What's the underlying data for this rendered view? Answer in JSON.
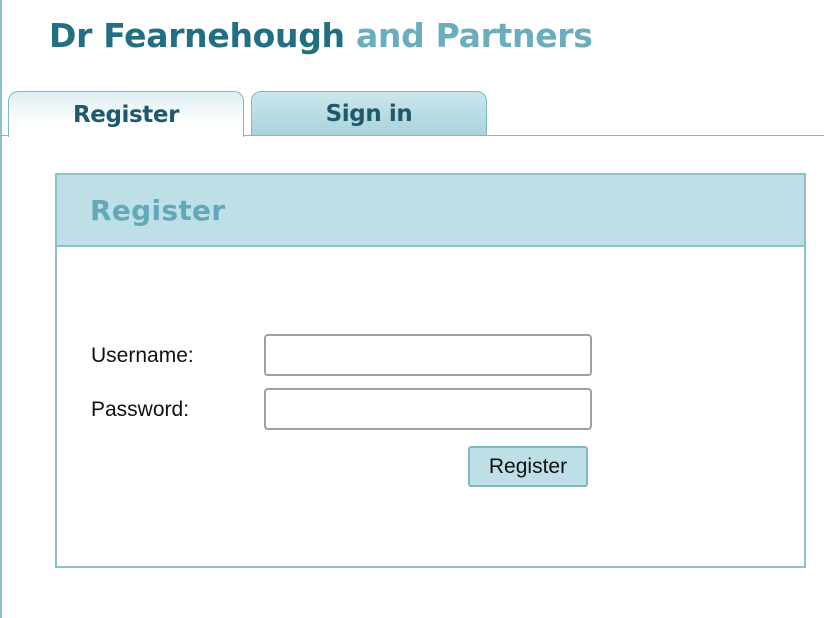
{
  "header": {
    "title_main": "Dr Fearnehough",
    "title_sub": "and Partners"
  },
  "tabs": [
    {
      "label": "Register",
      "active": true
    },
    {
      "label": "Sign in",
      "active": false
    }
  ],
  "panel": {
    "title": "Register",
    "fields": {
      "username": {
        "label": "Username:",
        "value": "",
        "placeholder": ""
      },
      "password": {
        "label": "Password:",
        "value": "",
        "placeholder": ""
      }
    },
    "submit_label": "Register"
  },
  "colors": {
    "brand_dark": "#226f84",
    "brand_light": "#6aaebe",
    "panel_header_bg": "#bedfe6",
    "border": "#8cc3cc"
  }
}
